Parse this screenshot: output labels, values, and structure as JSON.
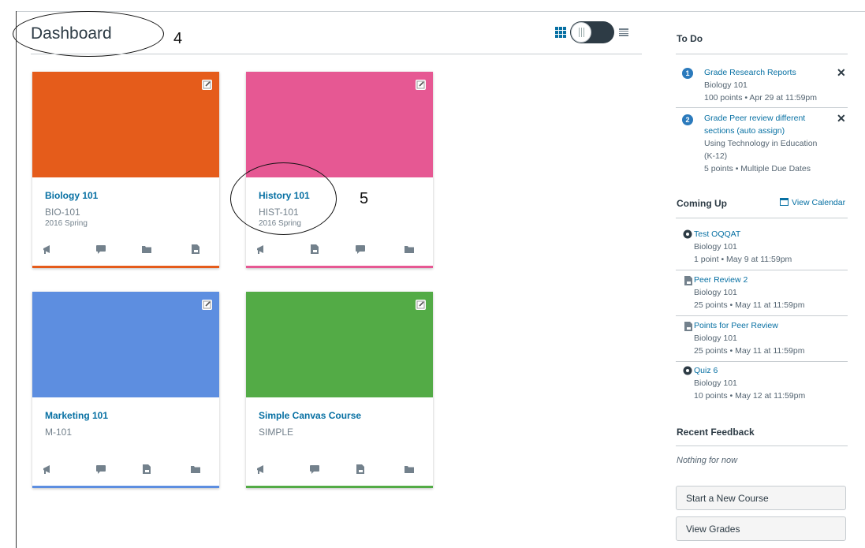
{
  "header": {
    "title": "Dashboard",
    "annotations": [
      "4",
      "5"
    ]
  },
  "courses": [
    {
      "title": "Biology 101",
      "code": "BIO-101",
      "term": "2016 Spring",
      "color": "#e55c1b",
      "actions": [
        "announcement-icon",
        "discussion-icon",
        "files-icon",
        "assignment-icon"
      ]
    },
    {
      "title": "History 101",
      "code": "HIST-101",
      "term": "2016 Spring",
      "color": "#e65893",
      "actions": [
        "announcement-icon",
        "assignment-icon",
        "discussion-icon",
        "files-icon"
      ]
    },
    {
      "title": "Marketing 101",
      "code": "M-101",
      "term": "",
      "color": "#5d8ee0",
      "actions": [
        "announcement-icon",
        "discussion-icon",
        "assignment-icon",
        "files-icon"
      ]
    },
    {
      "title": "Simple Canvas Course",
      "code": "SIMPLE",
      "term": "",
      "color": "#53ab46",
      "actions": [
        "announcement-icon",
        "discussion-icon",
        "assignment-icon",
        "files-icon"
      ]
    }
  ],
  "todo": {
    "heading": "To Do",
    "items": [
      {
        "badge": "1",
        "title": "Grade Research Reports",
        "lines": [
          "Biology 101",
          "100 points • Apr 29 at 11:59pm"
        ]
      },
      {
        "badge": "2",
        "title_lines": [
          "Grade Peer review different",
          "sections (auto assign)"
        ],
        "lines": [
          "Using Technology in Education",
          "(K-12)",
          "5 points • Multiple Due Dates"
        ]
      }
    ],
    "dismiss": "✕"
  },
  "coming_up": {
    "heading": "Coming Up",
    "calendar_link": "View Calendar",
    "items": [
      {
        "icon": "quiz-icon",
        "title": "Test OQQAT",
        "course": "Biology 101",
        "detail": "1 point • May 9 at 11:59pm"
      },
      {
        "icon": "assignment-icon",
        "title": "Peer Review 2",
        "course": "Biology 101",
        "detail": "25 points • May 11 at 11:59pm"
      },
      {
        "icon": "assignment-icon",
        "title": "Points for Peer Review",
        "course": "Biology 101",
        "detail": "25 points • May 11 at 11:59pm"
      },
      {
        "icon": "quiz-icon",
        "title": "Quiz 6",
        "course": "Biology 101",
        "detail": "10 points • May 12 at 11:59pm"
      }
    ]
  },
  "feedback": {
    "heading": "Recent Feedback",
    "empty": "Nothing for now"
  },
  "buttons": {
    "new_course": "Start a New Course",
    "view_grades": "View Grades"
  }
}
